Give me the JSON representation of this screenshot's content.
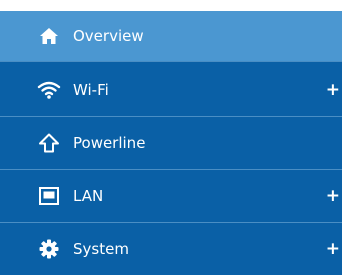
{
  "colors": {
    "active_bg": "#4b97d1",
    "item_bg": "#0a60a6",
    "divider": "#4a8ec4",
    "text": "#ffffff"
  },
  "nav": {
    "items": [
      {
        "label": "Overview",
        "icon": "home-icon",
        "expandable": false,
        "active": true
      },
      {
        "label": "Wi-Fi",
        "icon": "wifi-icon",
        "expandable": true,
        "active": false,
        "expand_glyph": "+"
      },
      {
        "label": "Powerline",
        "icon": "powerline-icon",
        "expandable": false,
        "active": false
      },
      {
        "label": "LAN",
        "icon": "lan-icon",
        "expandable": true,
        "active": false,
        "expand_glyph": "+"
      },
      {
        "label": "System",
        "icon": "gear-icon",
        "expandable": true,
        "active": false,
        "expand_glyph": "+"
      }
    ]
  }
}
